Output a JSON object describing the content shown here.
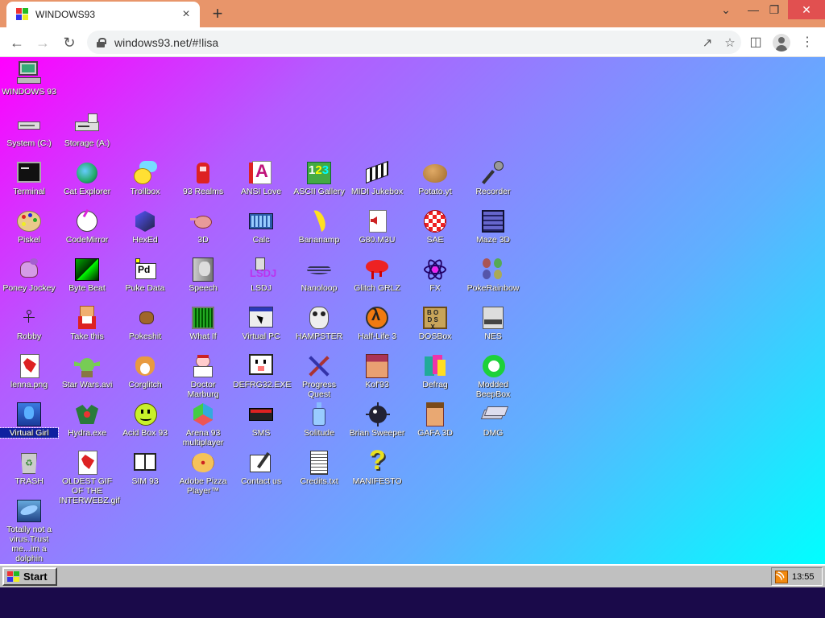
{
  "browser": {
    "tab_title": "WINDOWS93",
    "tab_close": "×",
    "new_tab": "+",
    "url": "windows93.net/#!lisa",
    "window_controls": {
      "dropdown": "⌄",
      "minimize": "—",
      "restore": "❐",
      "close": "✕"
    }
  },
  "desktop": {
    "icons": [
      {
        "label": "WINDOWS 93",
        "icon": "computer-icon"
      },
      {
        "label": "System (C:)",
        "icon": "drive-icon"
      },
      {
        "label": "Storage (A:)",
        "icon": "floppy-drive-icon"
      },
      {
        "label": "Terminal",
        "icon": "terminal-icon"
      },
      {
        "label": "Cat Explorer",
        "icon": "globe-cat-icon"
      },
      {
        "label": "Trollbox",
        "icon": "chat-troll-icon"
      },
      {
        "label": "93 Realms",
        "icon": "realms-icon"
      },
      {
        "label": "ANSI Love",
        "icon": "ansi-a-icon"
      },
      {
        "label": "ASCII Gallery",
        "icon": "ascii-123-icon"
      },
      {
        "label": "MIDI Jukebox",
        "icon": "piano-keys-icon"
      },
      {
        "label": "Potato.yt",
        "icon": "potato-icon"
      },
      {
        "label": "Recorder",
        "icon": "microphone-icon"
      },
      {
        "label": "Piskel",
        "icon": "palette-icon"
      },
      {
        "label": "CodeMirror",
        "icon": "unicorn-icon"
      },
      {
        "label": "HexEd",
        "icon": "cube-icon"
      },
      {
        "label": "3D",
        "icon": "teapot-icon"
      },
      {
        "label": "Calc",
        "icon": "calculator-icon"
      },
      {
        "label": "Bananamp",
        "icon": "banana-icon"
      },
      {
        "label": "G80.M3U",
        "icon": "audio-file-icon"
      },
      {
        "label": "SAE",
        "icon": "checker-ball-icon"
      },
      {
        "label": "Maze 3D",
        "icon": "maze-icon"
      },
      {
        "label": "Poney Jockey",
        "icon": "pony-icon"
      },
      {
        "label": "Byte Beat",
        "icon": "bytebeat-icon"
      },
      {
        "label": "Puke Data",
        "icon": "puke-data-icon"
      },
      {
        "label": "Speech",
        "icon": "speech-face-icon"
      },
      {
        "label": "LSDJ",
        "icon": "gameboy-icon"
      },
      {
        "label": "Nanoloop",
        "icon": "wave-icon"
      },
      {
        "label": "Glitch GRLZ",
        "icon": "lips-icon"
      },
      {
        "label": "FX",
        "icon": "atom-icon"
      },
      {
        "label": "PokeRainbow",
        "icon": "trainers-icon"
      },
      {
        "label": "Robby",
        "icon": "stick-figure-icon"
      },
      {
        "label": "Take this",
        "icon": "warrior-icon"
      },
      {
        "label": "Pokeshit",
        "icon": "poke-bag-icon"
      },
      {
        "label": "What If",
        "icon": "terminal-green-icon"
      },
      {
        "label": "Virtual PC",
        "icon": "window-cursor-icon"
      },
      {
        "label": "HAMPSTER",
        "icon": "owl-icon"
      },
      {
        "label": "Half-Life 3",
        "icon": "lambda-icon"
      },
      {
        "label": "DOSBox",
        "icon": "dosbox-icon"
      },
      {
        "label": "NES",
        "icon": "nes-icon"
      },
      {
        "label": "lenna.png",
        "icon": "image-file-icon"
      },
      {
        "label": "Star Wars.avi",
        "icon": "yoda-icon"
      },
      {
        "label": "Corglitch",
        "icon": "corgi-icon"
      },
      {
        "label": "Doctor Marburg",
        "icon": "doctor-icon"
      },
      {
        "label": "DEFRG32.EXE",
        "icon": "monitor-face-icon"
      },
      {
        "label": "Progress Quest",
        "icon": "crossed-swords-icon"
      },
      {
        "label": "Kof'93",
        "icon": "fighter-icon"
      },
      {
        "label": "Defrag",
        "icon": "defrag-icon"
      },
      {
        "label": "Modded BeepBox",
        "icon": "green-ring-icon"
      },
      {
        "label": "Virtual Girl",
        "icon": "virtual-girl-icon"
      },
      {
        "label": "Hydra.exe",
        "icon": "hydra-icon"
      },
      {
        "label": "Acid Box 93",
        "icon": "smiley-icon"
      },
      {
        "label": "Arena 93 multiplayer",
        "icon": "arena-cube-icon"
      },
      {
        "label": "SMS",
        "icon": "console-icon"
      },
      {
        "label": "Solitude",
        "icon": "bottle-icon"
      },
      {
        "label": "Brian Sweeper",
        "icon": "mine-icon"
      },
      {
        "label": "GAFA 3D",
        "icon": "face-icon"
      },
      {
        "label": "DMG",
        "icon": "cash-icon"
      },
      {
        "label": "TRASH",
        "icon": "trash-icon"
      },
      {
        "label": "OLDEST GIF OF THE INTERWEBZ.gif",
        "icon": "image-file-icon"
      },
      {
        "label": "SIM 93",
        "icon": "book-icon"
      },
      {
        "label": "Adobe Pizza Player™",
        "icon": "pizza-icon"
      },
      {
        "label": "Contact us",
        "icon": "contact-icon"
      },
      {
        "label": "Credits.txt",
        "icon": "text-file-icon"
      },
      {
        "label": "MANIFESTO",
        "icon": "question-mark-icon"
      },
      {
        "label": "Totally not a virus.Trust me...im a dolphin",
        "icon": "dolphin-icon"
      }
    ]
  },
  "taskbar": {
    "start_label": "Start",
    "clock": "13:55"
  }
}
